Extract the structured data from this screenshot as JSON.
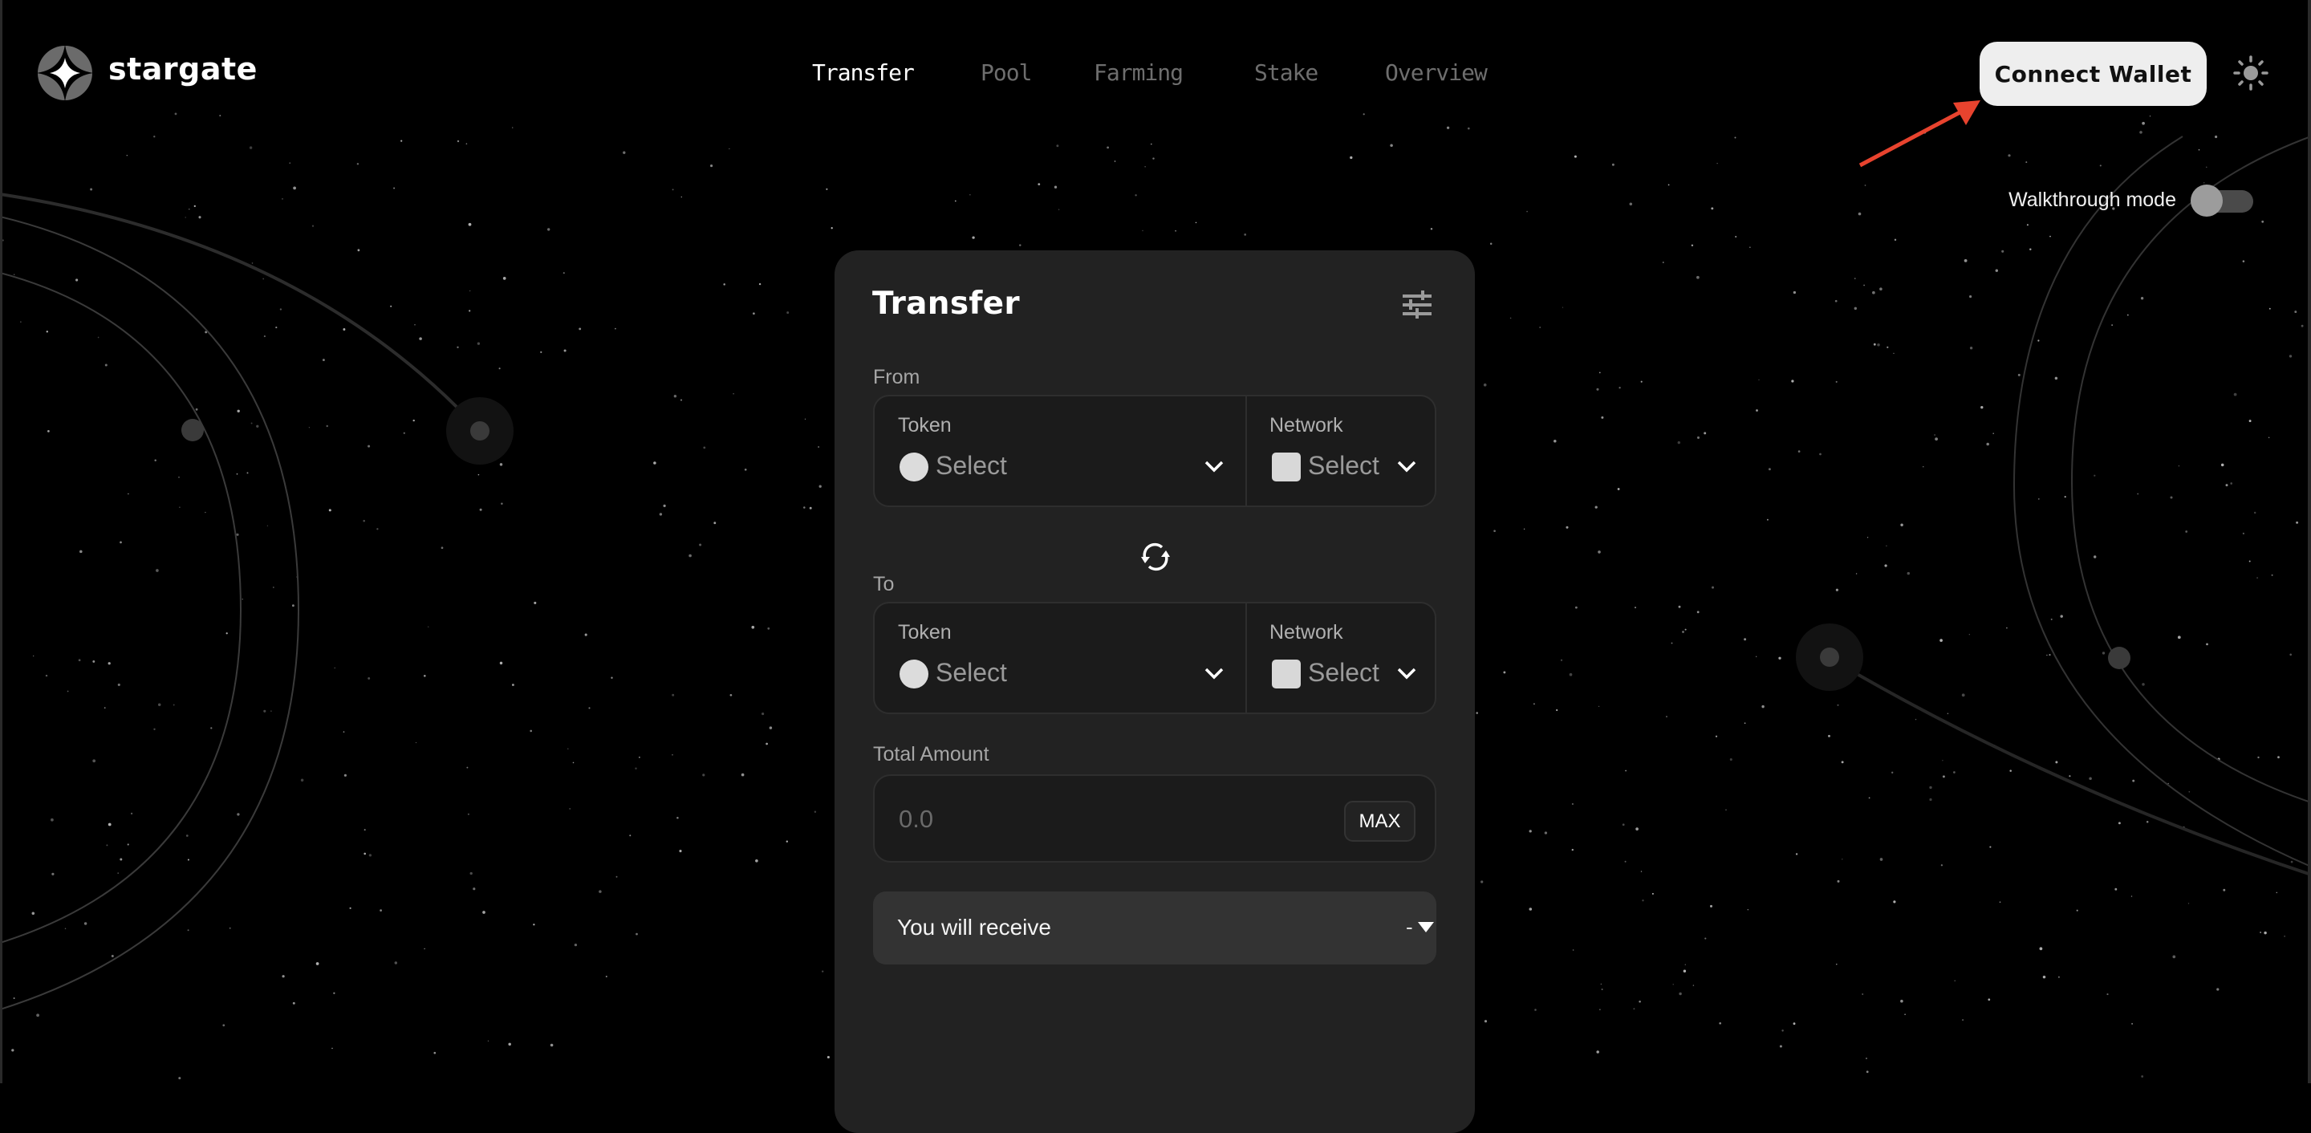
{
  "header": {
    "brand": "stargate",
    "nav": [
      {
        "label": "Transfer",
        "active": true
      },
      {
        "label": "Pool",
        "active": false
      },
      {
        "label": "Farming",
        "active": false
      },
      {
        "label": "Stake",
        "active": false
      },
      {
        "label": "Overview",
        "active": false
      }
    ],
    "connect_wallet_label": "Connect Wallet",
    "theme_icon": "sun-icon",
    "walkthrough_label": "Walkthrough mode",
    "walkthrough_enabled": false
  },
  "annotation": {
    "type": "arrow",
    "color": "#e8432e",
    "points_to": "Connect Wallet"
  },
  "transfer_card": {
    "title": "Transfer",
    "settings_icon": "sliders-icon",
    "from": {
      "label": "From",
      "token": {
        "label": "Token",
        "value": "Select"
      },
      "network": {
        "label": "Network",
        "value": "Select"
      }
    },
    "swap_icon": "swap-arrows-icon",
    "to": {
      "label": "To",
      "token": {
        "label": "Token",
        "value": "Select"
      },
      "network": {
        "label": "Network",
        "value": "Select"
      }
    },
    "amount": {
      "label": "Total Amount",
      "placeholder": "0.0",
      "value": "",
      "max_label": "MAX"
    },
    "receive": {
      "label": "You will receive",
      "value": "-"
    }
  },
  "colors": {
    "background": "#000000",
    "card": "#222222",
    "field": "#1b1b1b",
    "receive_bg": "#333333",
    "nav_inactive": "#6e6e6e",
    "button_bg": "#eeeeee",
    "annotation_red": "#e8432e"
  }
}
